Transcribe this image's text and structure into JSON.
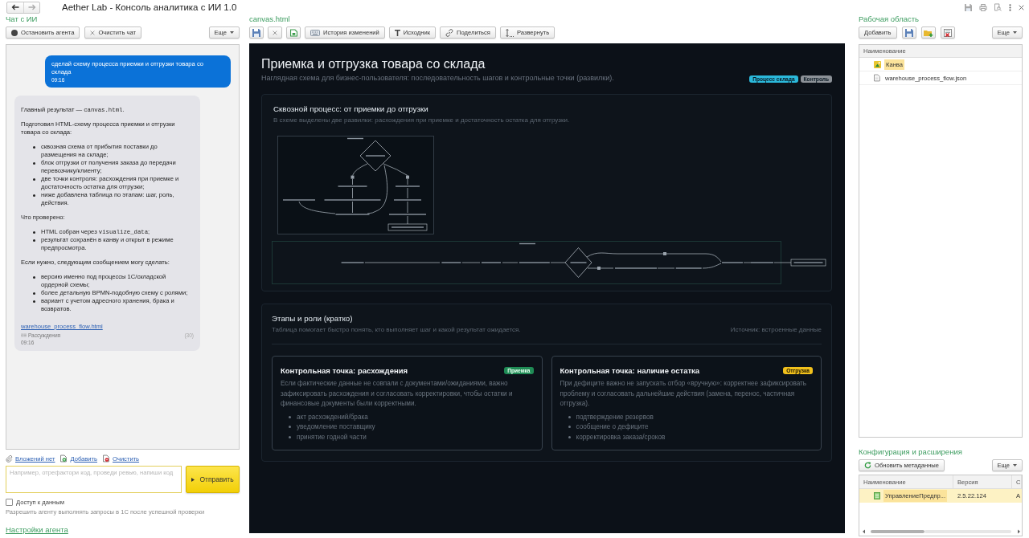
{
  "window": {
    "title": "Aether Lab - Консоль аналитика с ИИ 1.0"
  },
  "chat_panel": {
    "title": "Чат с ИИ",
    "toolbar": [
      {
        "kind": "stop",
        "label": "Остановить агента"
      },
      {
        "kind": "clear",
        "label": "Очистить чат"
      }
    ],
    "more_button": "Еще",
    "messages": [
      {
        "kind": "user",
        "text": "сделай схему процесса приемки и отгрузки товара со склада",
        "time": "09:16"
      },
      {
        "kind": "assistant",
        "blocks": [
          {
            "kind": "paragraph",
            "text": [
              {
                "text": "Главный результат — ",
                "code": false
              },
              {
                "text": "canvas.html",
                "code": true
              },
              {
                "text": ".",
                "code": false
              }
            ]
          },
          {
            "kind": "paragraph",
            "text": "Подготовил HTML-схему процесса приемки и отгрузки товара со склада:"
          },
          {
            "kind": "list",
            "items": [
              "сквозная схема от прибытия поставки до размещения на складе;",
              "блок отгрузки от получения заказа до передачи перевозчику/клиенту;",
              "две точки контроля: расхождения при приемке и достаточность остатка для отгрузки;",
              "ниже добавлена таблица по этапам: шаг, роль, действия."
            ]
          },
          {
            "kind": "paragraph",
            "text": "Что проверено:"
          },
          {
            "kind": "list",
            "items": [
              [
                {
                  "text": "HTML собран через ",
                  "code": false
                },
                {
                  "text": "visualize_data",
                  "code": true
                },
                {
                  "text": ";",
                  "code": false
                }
              ],
              "результат сохранён в канву и открыт в режиме предпросмотра."
            ]
          },
          {
            "kind": "paragraph",
            "text": "Если нужно, следующим сообщением могу сделать:"
          },
          {
            "kind": "list",
            "items": [
              "версию именно под процессы 1С/складской ордерной схемы;",
              "более детальную BPMN-подобную схему с ролями;",
              "вариант с учетом адресного хранения, брака и возвратов."
            ]
          }
        ],
        "link": "warehouse_process_flow.html",
        "reasoning": "Рассуждения",
        "count": "(30)",
        "time": "09:16"
      }
    ],
    "attachments": [
      {
        "kind": "clip",
        "label": "Вложений нет"
      },
      {
        "kind": "add",
        "label": "Добавить"
      },
      {
        "kind": "remove",
        "label": "Очистить"
      }
    ],
    "input": {
      "placeholder": "Например, отрефактори код, проведи ревью, напиши код"
    },
    "send_button": "Отправить",
    "data_access": {
      "label": "Доступ к данным",
      "checked": false
    },
    "hint": "Разрешить агенту выполнять запросы в 1С после успешной проверки",
    "settings_link": "Настройки агента"
  },
  "canvas_panel": {
    "title": "canvas.html",
    "toolbar": [
      {
        "kind": "save"
      },
      {
        "kind": "close"
      },
      {
        "kind": "export"
      },
      {
        "kind": "history",
        "label": "История изменений"
      },
      {
        "kind": "source",
        "label": "Исходник"
      },
      {
        "kind": "share",
        "label": "Поделиться"
      },
      {
        "kind": "expand",
        "label": "Развернуть"
      }
    ],
    "page": {
      "title": "Приемка и отгрузка товара со склада",
      "subtitle": "Наглядная схема для бизнес-пользователя: последовательность шагов и контрольные точки (развилки).",
      "tags": [
        {
          "label": "Процесс склада",
          "color": "#2bb8da"
        },
        {
          "label": "Контроль",
          "color": "#8c9197"
        }
      ],
      "sections": [
        {
          "kind": "diagram",
          "title": "Сквозной процесс: от приемки до отгрузки",
          "subtitle": "В схеме выделены две развилки: расхождения при приемке и достаточность остатка для отгрузки."
        },
        {
          "kind": "cards",
          "title": "Этапы и роли (кратко)",
          "subtitle": "Таблица помогает быстро понять, кто выполняет шаг и какой результат ожидается.",
          "source": "Источник: встроенные данные",
          "cards": [
            {
              "title": "Контрольная точка: расхождения",
              "badge": "Приемка",
              "color": "#1f8b55",
              "text": "Если фактические данные не совпали с документами/ожиданиями, важно зафиксировать расхождения и согласовать корректировки, чтобы остатки и финансовые документы были корректными.",
              "items": [
                "акт расхождений/брака",
                "уведомление поставщику",
                "принятие годной части"
              ]
            },
            {
              "title": "Контрольная точка: наличие остатка",
              "badge": "Отгрузка",
              "color": "#f2c11c",
              "text": "При дефиците важно не запускать отбор «вручную»: корректнее зафиксировать проблему и согласовать дальнейшие действия (замена, перенос, частичная отгрузка).",
              "items": [
                "подтверждение резервов",
                "сообщение о дефиците",
                "корректировка заказа/сроков"
              ]
            }
          ]
        }
      ]
    }
  },
  "workspace_panel": {
    "title": "Рабочая область",
    "add_button": "Добавить",
    "tools": [
      {
        "kind": "save"
      },
      {
        "kind": "add-folder"
      },
      {
        "kind": "delete"
      }
    ],
    "more_button": "Еще",
    "table": {
      "columns": [
        "Наименование"
      ],
      "rows": [
        {
          "kind": "canvas",
          "name": "Канва",
          "selected": true
        },
        {
          "kind": "file",
          "name": "warehouse_process_flow.json",
          "selected": false
        }
      ]
    }
  },
  "config_panel": {
    "title": "Конфигурация и расширения",
    "refresh_button": "Обновить метаданные",
    "more_button": "Еще",
    "table": {
      "columns": [
        "Наименование",
        "Версия",
        "С"
      ],
      "rows": [
        {
          "cells": [
            "УправлениеПредпр...",
            "2.5.22.124",
            "А"
          ],
          "selected": true
        }
      ]
    }
  }
}
